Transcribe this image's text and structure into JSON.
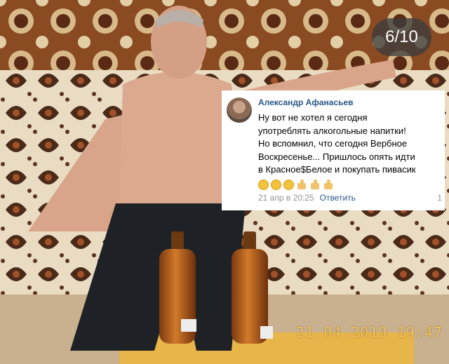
{
  "viewer": {
    "counter": "6/10"
  },
  "comment": {
    "author": "Александр Афанасьев",
    "text_lines": [
      "Ну вот не хотел я сегодня",
      "употреблять алкогольные напитки!",
      "Но вспомнил, что сегодня Вербное",
      "Воскресенье... Пришлось опять идти",
      "в Красное$Белое и покупать пивасик"
    ],
    "emojis": [
      "laughing-face",
      "laughing-face",
      "laughing-face",
      "thumbs-up",
      "thumbs-up",
      "thumbs-up"
    ],
    "date": "21 апр в 20:25",
    "reply_label": "Ответить",
    "likes": "1"
  },
  "photo": {
    "datestamp": "21.04.2019 19:47"
  },
  "colors": {
    "link": "#2a5885",
    "meta": "#939393",
    "counter_bg": "#3c3c3c",
    "datestamp": "#f3c25a"
  }
}
